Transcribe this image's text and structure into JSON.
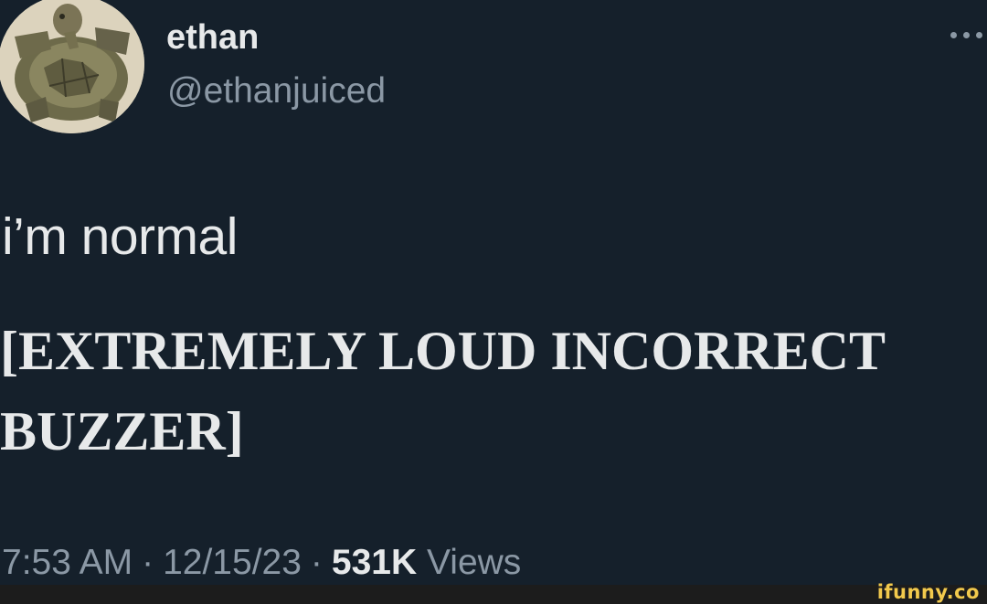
{
  "tweet": {
    "display_name": "ethan",
    "handle": "@ethanjuiced",
    "avatar_icon": "turtle-avatar",
    "more_icon": "more-options-icon",
    "text": "i’m normal",
    "caption": "[EXTREMELY LOUD INCORRECT BUZZER]",
    "time": "7:53 AM",
    "date": "12/15/23",
    "views_count": "531K",
    "views_label": "Views",
    "separator": "·"
  },
  "watermark": {
    "text": "ifunny.co"
  },
  "colors": {
    "background": "#15202b",
    "primary_text": "#e7e9ea",
    "secondary_text": "#8b98a5",
    "watermark": "#f2c94c"
  }
}
